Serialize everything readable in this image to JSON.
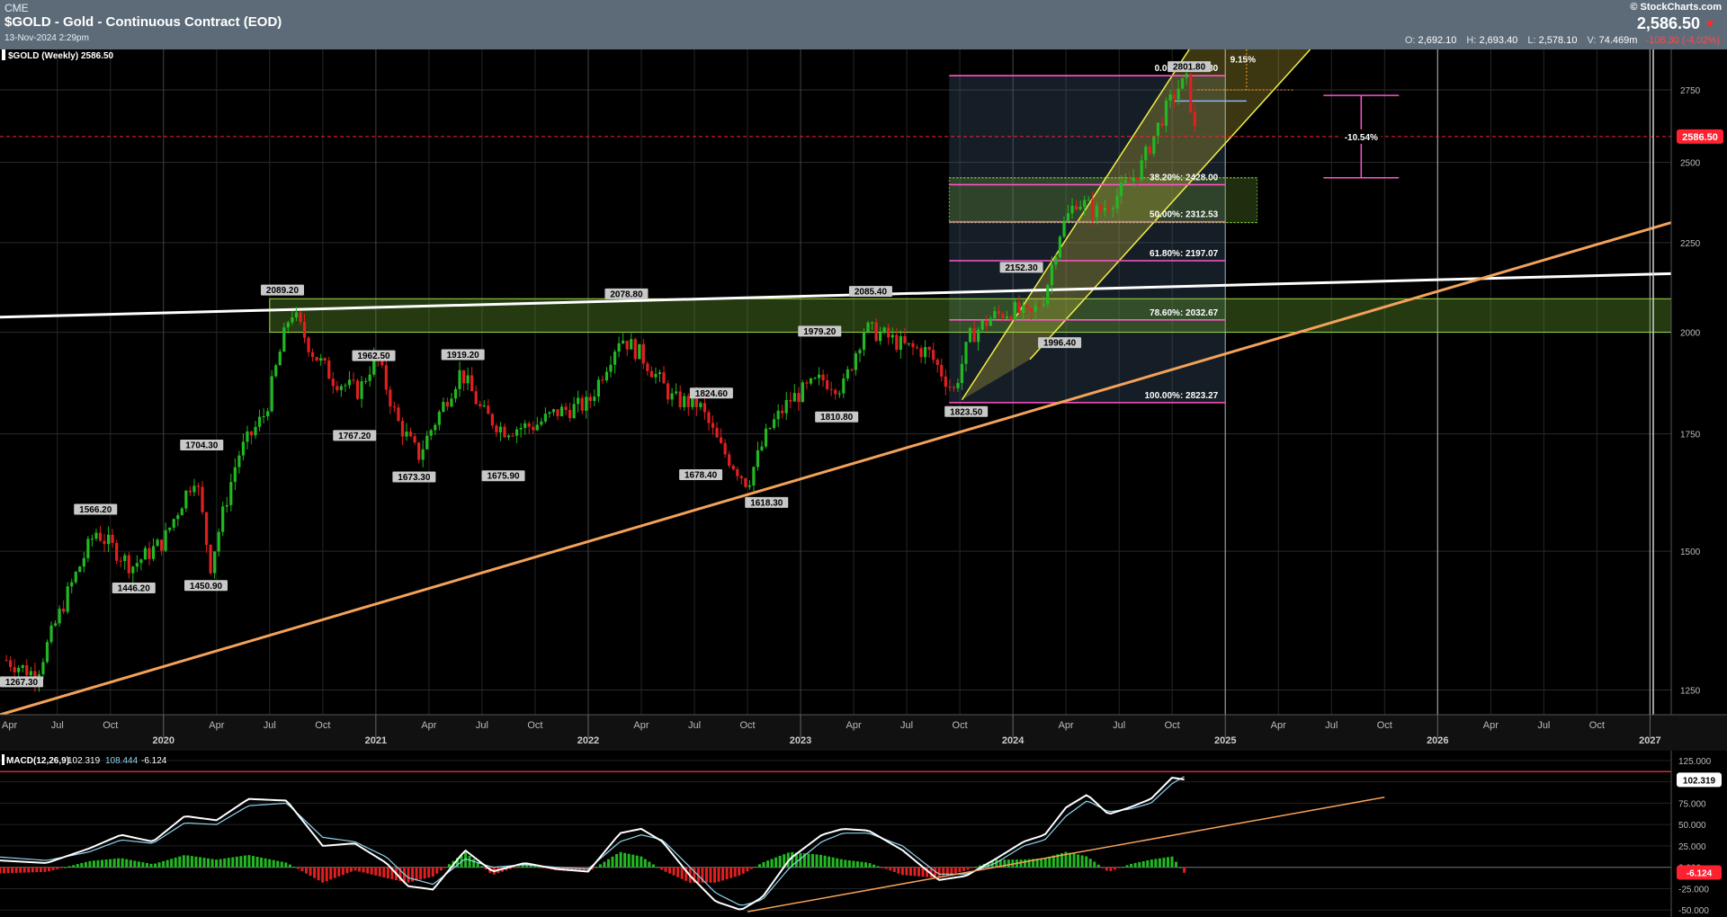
{
  "header": {
    "exchange": "CME",
    "title": "$GOLD - Gold - Continuous Contract (EOD)",
    "datetime": "13-Nov-2024 2:29pm",
    "brand": "© StockCharts.com",
    "last_price": "2,586.50",
    "ohlc": {
      "o_label": "O:",
      "o": "2,692.10",
      "h_label": "H:",
      "h": "2,693.40",
      "l_label": "L:",
      "l": "2,578.10",
      "v_label": "V:",
      "v": "74.469m",
      "change": "-108.30 (-4.02%)"
    }
  },
  "colors": {
    "background": "#000000",
    "header": "#5d6b79",
    "up_candle": "#22b822",
    "down_candle": "#e02020",
    "fib": "#ff55c8",
    "channel": "#f2ef4a",
    "trend_orange": "#f4a25a",
    "resistance": "#ffffff",
    "zone": "#6ea632",
    "price_tag": "#ff2030",
    "macd_line": "#ffffff",
    "signal_line": "#8fd6ee"
  },
  "chart_data": [
    {
      "type": "candlestick",
      "legend": "$GOLD (Weekly) 2586.50",
      "x_axis": {
        "months": [
          "Jul",
          "Oct",
          "Apr",
          "Jul",
          "Oct",
          "Apr",
          "Jul",
          "Oct",
          "Apr",
          "Jul",
          "Oct",
          "Apr",
          "Jul",
          "Oct",
          "Apr",
          "Jul",
          "Oct",
          "Apr",
          "Jul",
          "Oct",
          "Apr",
          "Jul",
          "Oct",
          "Apr",
          "Jul",
          "Oct"
        ],
        "month_times": [
          2019.5,
          2019.75,
          2020.25,
          2020.5,
          2020.75,
          2021.25,
          2021.5,
          2021.75,
          2022.25,
          2022.5,
          2022.75,
          2023.25,
          2023.5,
          2023.75,
          2024.25,
          2024.5,
          2024.75,
          2025.25,
          2025.5,
          2025.75,
          2026.25,
          2026.5,
          2026.75,
          2027.25,
          2027.5,
          2027.75
        ],
        "years": [
          "2020",
          "2021",
          "2022",
          "2023",
          "2024",
          "2025",
          "2026",
          "2027"
        ],
        "year_times": [
          2020,
          2021,
          2022,
          2023,
          2024,
          2025,
          2026,
          2027
        ],
        "first_label": "Apr",
        "range": [
          2019.23,
          2027.1
        ]
      },
      "y_axis": {
        "scale": "log",
        "range": [
          1210,
          2900
        ],
        "ticks": [
          1250,
          1500,
          1750,
          2000,
          2250,
          2500,
          2750
        ]
      },
      "current_price_label": "2586.50",
      "current_price": 2586.5,
      "price_anchors": [
        [
          2019.26,
          1300
        ],
        [
          2019.4,
          1275
        ],
        [
          2019.55,
          1420
        ],
        [
          2019.68,
          1540
        ],
        [
          2019.85,
          1470
        ],
        [
          2020.0,
          1520
        ],
        [
          2020.15,
          1660
        ],
        [
          2020.22,
          1470
        ],
        [
          2020.35,
          1700
        ],
        [
          2020.48,
          1800
        ],
        [
          2020.6,
          2060
        ],
        [
          2020.7,
          1950
        ],
        [
          2020.8,
          1880
        ],
        [
          2020.92,
          1850
        ],
        [
          2021.0,
          1940
        ],
        [
          2021.1,
          1780
        ],
        [
          2021.2,
          1700
        ],
        [
          2021.4,
          1900
        ],
        [
          2021.5,
          1800
        ],
        [
          2021.6,
          1760
        ],
        [
          2021.75,
          1770
        ],
        [
          2021.85,
          1800
        ],
        [
          2022.0,
          1820
        ],
        [
          2022.15,
          1990
        ],
        [
          2022.25,
          1940
        ],
        [
          2022.4,
          1830
        ],
        [
          2022.52,
          1820
        ],
        [
          2022.62,
          1720
        ],
        [
          2022.75,
          1640
        ],
        [
          2022.85,
          1760
        ],
        [
          2022.95,
          1830
        ],
        [
          2023.1,
          1880
        ],
        [
          2023.2,
          1860
        ],
        [
          2023.3,
          2010
        ],
        [
          2023.4,
          1990
        ],
        [
          2023.5,
          1960
        ],
        [
          2023.6,
          1950
        ],
        [
          2023.72,
          1850
        ],
        [
          2023.8,
          1990
        ],
        [
          2023.9,
          2040
        ],
        [
          2024.0,
          2060
        ],
        [
          2024.08,
          2040
        ],
        [
          2024.15,
          2100
        ],
        [
          2024.22,
          2280
        ],
        [
          2024.3,
          2380
        ],
        [
          2024.4,
          2340
        ],
        [
          2024.5,
          2400
        ],
        [
          2024.6,
          2480
        ],
        [
          2024.7,
          2650
        ],
        [
          2024.78,
          2760
        ],
        [
          2024.82,
          2780
        ],
        [
          2024.86,
          2586
        ]
      ],
      "price_labels": [
        {
          "text": "1267.30",
          "t": 2019.26,
          "price": 1262,
          "pos": "left"
        },
        {
          "text": "1566.20",
          "t": 2019.68,
          "price": 1566.2,
          "pos": "above"
        },
        {
          "text": "1446.20",
          "t": 2019.86,
          "price": 1446.2,
          "pos": "below"
        },
        {
          "text": "1450.90",
          "t": 2020.2,
          "price": 1450.9,
          "pos": "below"
        },
        {
          "text": "1704.30",
          "t": 2020.18,
          "price": 1704.3,
          "pos": "above"
        },
        {
          "text": "2089.20",
          "t": 2020.56,
          "price": 2089.2,
          "pos": "above"
        },
        {
          "text": "1962.50",
          "t": 2020.99,
          "price": 1962.5,
          "pos": "below"
        },
        {
          "text": "1767.20",
          "t": 2020.9,
          "price": 1767.2,
          "pos": "below"
        },
        {
          "text": "1673.30",
          "t": 2021.18,
          "price": 1673.3,
          "pos": "below"
        },
        {
          "text": "1919.20",
          "t": 2021.41,
          "price": 1919.2,
          "pos": "above"
        },
        {
          "text": "1675.90",
          "t": 2021.6,
          "price": 1675.9,
          "pos": "below"
        },
        {
          "text": "2078.80",
          "t": 2022.18,
          "price": 2078.8,
          "pos": "above"
        },
        {
          "text": "1824.60",
          "t": 2022.58,
          "price": 1824.6,
          "pos": "above"
        },
        {
          "text": "1678.40",
          "t": 2022.53,
          "price": 1678.4,
          "pos": "below"
        },
        {
          "text": "1618.30",
          "t": 2022.84,
          "price": 1618.3,
          "pos": "below"
        },
        {
          "text": "1979.20",
          "t": 2023.09,
          "price": 1979.2,
          "pos": "above"
        },
        {
          "text": "1810.80",
          "t": 2023.17,
          "price": 1810.8,
          "pos": "below"
        },
        {
          "text": "2085.40",
          "t": 2023.33,
          "price": 2085.4,
          "pos": "above"
        },
        {
          "text": "1823.50",
          "t": 2023.78,
          "price": 1823.5,
          "pos": "below"
        },
        {
          "text": "2152.30",
          "t": 2024.04,
          "price": 2152.3,
          "pos": "above"
        },
        {
          "text": "1996.40",
          "t": 2024.22,
          "price": 1996.4,
          "pos": "below"
        },
        {
          "text": "2801.80",
          "t": 2024.83,
          "price": 2801.8,
          "pos": "above"
        }
      ],
      "fibonacci": {
        "t_start": 2023.7,
        "t_end": 2025.0,
        "levels": [
          {
            "label": "0.00%: 2801.80",
            "price": 2801.8
          },
          {
            "label": "38.20%: 2428.00",
            "price": 2428.0
          },
          {
            "label": "50.00%: 2312.53",
            "price": 2312.53
          },
          {
            "label": "61.80%: 2197.07",
            "price": 2197.07
          },
          {
            "label": "78.60%: 2032.67",
            "price": 2032.67
          },
          {
            "label": "100.00%: 2823.27",
            "price": 1823.27
          }
        ]
      },
      "annotations": {
        "pct_up": "9.15%",
        "pct_down": "-10.54%"
      }
    },
    {
      "type": "line",
      "title": "MACD(12,26,9)",
      "values_text": {
        "macd": "102.319",
        "signal": "108.444",
        "hist": "-6.124"
      },
      "y_axis": {
        "range": [
          -55,
          128
        ],
        "ticks": [
          "125.000",
          "100.000",
          "75.000",
          "50.000",
          "25.000",
          "0.000",
          "-25.000",
          "-50.000"
        ],
        "tick_values": [
          125,
          100,
          75,
          50,
          25,
          0,
          -25,
          -50
        ]
      },
      "right_tags": {
        "macd": "102.319",
        "hist": "-6.124"
      },
      "macd_anchors": [
        [
          2019.23,
          8
        ],
        [
          2019.45,
          5
        ],
        [
          2019.65,
          22
        ],
        [
          2019.8,
          38
        ],
        [
          2019.95,
          30
        ],
        [
          2020.1,
          60
        ],
        [
          2020.25,
          55
        ],
        [
          2020.4,
          80
        ],
        [
          2020.58,
          78
        ],
        [
          2020.75,
          25
        ],
        [
          2020.9,
          28
        ],
        [
          2021.05,
          5
        ],
        [
          2021.15,
          -22
        ],
        [
          2021.27,
          -26
        ],
        [
          2021.42,
          20
        ],
        [
          2021.55,
          -5
        ],
        [
          2021.7,
          5
        ],
        [
          2021.85,
          -2
        ],
        [
          2022.0,
          -5
        ],
        [
          2022.15,
          40
        ],
        [
          2022.25,
          45
        ],
        [
          2022.35,
          30
        ],
        [
          2022.48,
          -10
        ],
        [
          2022.6,
          -40
        ],
        [
          2022.72,
          -50
        ],
        [
          2022.82,
          -35
        ],
        [
          2022.95,
          10
        ],
        [
          2023.1,
          38
        ],
        [
          2023.2,
          45
        ],
        [
          2023.32,
          43
        ],
        [
          2023.48,
          20
        ],
        [
          2023.65,
          -15
        ],
        [
          2023.78,
          -10
        ],
        [
          2023.92,
          10
        ],
        [
          2024.05,
          30
        ],
        [
          2024.15,
          38
        ],
        [
          2024.25,
          70
        ],
        [
          2024.35,
          85
        ],
        [
          2024.45,
          62
        ],
        [
          2024.55,
          70
        ],
        [
          2024.65,
          80
        ],
        [
          2024.75,
          105
        ],
        [
          2024.82,
          102
        ]
      ],
      "signal_anchors": [
        [
          2019.23,
          12
        ],
        [
          2019.45,
          8
        ],
        [
          2019.65,
          18
        ],
        [
          2019.8,
          32
        ],
        [
          2019.95,
          28
        ],
        [
          2020.1,
          52
        ],
        [
          2020.25,
          50
        ],
        [
          2020.4,
          72
        ],
        [
          2020.58,
          75
        ],
        [
          2020.75,
          35
        ],
        [
          2020.9,
          30
        ],
        [
          2021.05,
          12
        ],
        [
          2021.15,
          -12
        ],
        [
          2021.27,
          -20
        ],
        [
          2021.42,
          10
        ],
        [
          2021.55,
          0
        ],
        [
          2021.7,
          3
        ],
        [
          2021.85,
          0
        ],
        [
          2022.0,
          -2
        ],
        [
          2022.15,
          30
        ],
        [
          2022.25,
          38
        ],
        [
          2022.35,
          32
        ],
        [
          2022.48,
          0
        ],
        [
          2022.6,
          -30
        ],
        [
          2022.72,
          -45
        ],
        [
          2022.82,
          -38
        ],
        [
          2022.95,
          0
        ],
        [
          2023.1,
          30
        ],
        [
          2023.2,
          40
        ],
        [
          2023.32,
          40
        ],
        [
          2023.48,
          25
        ],
        [
          2023.65,
          -8
        ],
        [
          2023.78,
          -8
        ],
        [
          2023.92,
          5
        ],
        [
          2024.05,
          25
        ],
        [
          2024.15,
          32
        ],
        [
          2024.25,
          60
        ],
        [
          2024.35,
          78
        ],
        [
          2024.45,
          65
        ],
        [
          2024.55,
          68
        ],
        [
          2024.65,
          75
        ],
        [
          2024.75,
          98
        ],
        [
          2024.82,
          108
        ]
      ]
    }
  ]
}
